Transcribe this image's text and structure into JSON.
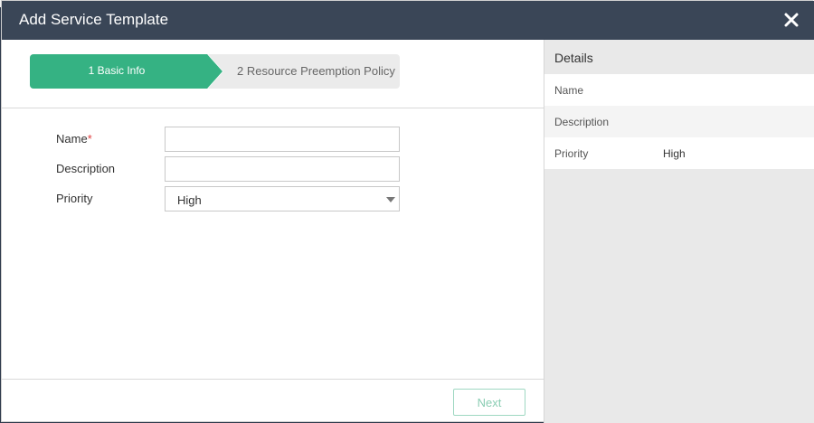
{
  "dialog": {
    "title": "Add Service Template",
    "close_icon": "close-icon"
  },
  "wizard": {
    "steps": [
      {
        "label": "1 Basic Info",
        "state": "active"
      },
      {
        "label": "2 Resource Preemption Policy",
        "state": "inactive"
      }
    ],
    "active_color": "#35b283"
  },
  "form": {
    "name": {
      "label": "Name",
      "required_mark": "*",
      "value": ""
    },
    "description": {
      "label": "Description",
      "value": ""
    },
    "priority": {
      "label": "Priority",
      "selected": "High"
    }
  },
  "footer": {
    "next_label": "Next"
  },
  "details": {
    "title": "Details",
    "rows": [
      {
        "key": "Name",
        "value": ""
      },
      {
        "key": "Description",
        "value": ""
      },
      {
        "key": "Priority",
        "value": "High"
      }
    ]
  }
}
